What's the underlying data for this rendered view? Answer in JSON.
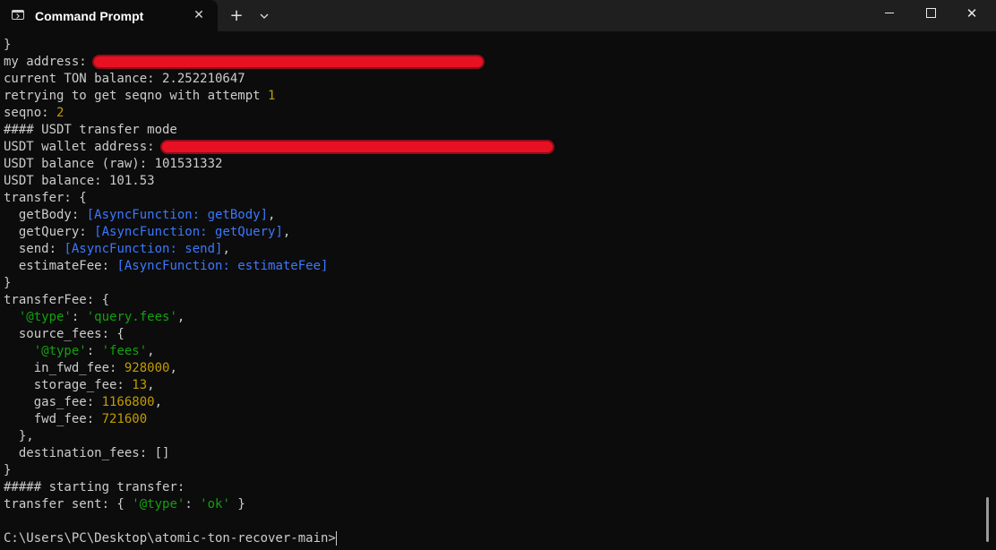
{
  "window": {
    "tab_title": "Command Prompt",
    "tab_icon": "terminal-icon",
    "close_tab_glyph": "✕",
    "new_tab_glyph": "+",
    "minimize_label": "",
    "maximize_label": "",
    "close_glyph": "✕"
  },
  "colors": {
    "background": "#0c0c0c",
    "text": "#cccccc",
    "number": "#c19c00",
    "string": "#13a10e",
    "function": "#3b78ff",
    "redaction": "#e81123"
  },
  "terminal": {
    "lines": [
      [
        {
          "t": "}",
          "c": "white"
        }
      ],
      [
        {
          "t": "my address: ",
          "c": "white"
        },
        {
          "redact": true
        }
      ],
      [
        {
          "t": "current TON balance: 2.252210647",
          "c": "white"
        }
      ],
      [
        {
          "t": "retrying to get seqno with attempt ",
          "c": "white"
        },
        {
          "t": "1",
          "c": "yellow"
        }
      ],
      [
        {
          "t": "seqno: ",
          "c": "white"
        },
        {
          "t": "2",
          "c": "yellow"
        }
      ],
      [
        {
          "t": "#### USDT transfer mode",
          "c": "white"
        }
      ],
      [
        {
          "t": "USDT wallet address: ",
          "c": "white"
        },
        {
          "redact": true
        }
      ],
      [
        {
          "t": "USDT balance (raw): 101531332",
          "c": "white"
        }
      ],
      [
        {
          "t": "USDT balance: 101.53",
          "c": "white"
        }
      ],
      [
        {
          "t": "transfer: {",
          "c": "white"
        }
      ],
      [
        {
          "t": "  getBody: ",
          "c": "white"
        },
        {
          "t": "[AsyncFunction: getBody]",
          "c": "blue"
        },
        {
          "t": ",",
          "c": "white"
        }
      ],
      [
        {
          "t": "  getQuery: ",
          "c": "white"
        },
        {
          "t": "[AsyncFunction: getQuery]",
          "c": "blue"
        },
        {
          "t": ",",
          "c": "white"
        }
      ],
      [
        {
          "t": "  send: ",
          "c": "white"
        },
        {
          "t": "[AsyncFunction: send]",
          "c": "blue"
        },
        {
          "t": ",",
          "c": "white"
        }
      ],
      [
        {
          "t": "  estimateFee: ",
          "c": "white"
        },
        {
          "t": "[AsyncFunction: estimateFee]",
          "c": "blue"
        }
      ],
      [
        {
          "t": "}",
          "c": "white"
        }
      ],
      [
        {
          "t": "transferFee: {",
          "c": "white"
        }
      ],
      [
        {
          "t": "  ",
          "c": "white"
        },
        {
          "t": "'@type'",
          "c": "green"
        },
        {
          "t": ": ",
          "c": "white"
        },
        {
          "t": "'query.fees'",
          "c": "green"
        },
        {
          "t": ",",
          "c": "white"
        }
      ],
      [
        {
          "t": "  source_fees: {",
          "c": "white"
        }
      ],
      [
        {
          "t": "    ",
          "c": "white"
        },
        {
          "t": "'@type'",
          "c": "green"
        },
        {
          "t": ": ",
          "c": "white"
        },
        {
          "t": "'fees'",
          "c": "green"
        },
        {
          "t": ",",
          "c": "white"
        }
      ],
      [
        {
          "t": "    in_fwd_fee: ",
          "c": "white"
        },
        {
          "t": "928000",
          "c": "yellow"
        },
        {
          "t": ",",
          "c": "white"
        }
      ],
      [
        {
          "t": "    storage_fee: ",
          "c": "white"
        },
        {
          "t": "13",
          "c": "yellow"
        },
        {
          "t": ",",
          "c": "white"
        }
      ],
      [
        {
          "t": "    gas_fee: ",
          "c": "white"
        },
        {
          "t": "1166800",
          "c": "yellow"
        },
        {
          "t": ",",
          "c": "white"
        }
      ],
      [
        {
          "t": "    fwd_fee: ",
          "c": "white"
        },
        {
          "t": "721600",
          "c": "yellow"
        }
      ],
      [
        {
          "t": "  },",
          "c": "white"
        }
      ],
      [
        {
          "t": "  destination_fees: []",
          "c": "white"
        }
      ],
      [
        {
          "t": "}",
          "c": "white"
        }
      ],
      [
        {
          "t": "##### starting transfer:",
          "c": "white"
        }
      ],
      [
        {
          "t": "transfer sent: { ",
          "c": "white"
        },
        {
          "t": "'@type'",
          "c": "green"
        },
        {
          "t": ": ",
          "c": "white"
        },
        {
          "t": "'ok'",
          "c": "green"
        },
        {
          "t": " }",
          "c": "white"
        }
      ]
    ],
    "prompt": "C:\\Users\\PC\\Desktop\\atomic-ton-recover-main>"
  }
}
